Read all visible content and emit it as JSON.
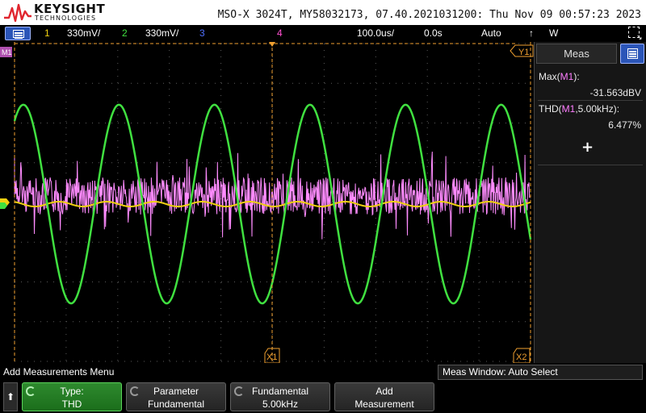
{
  "header": {
    "brand": "KEYSIGHT",
    "sub": "TECHNOLOGIES",
    "title": "MSO-X 3024T, MY58032173, 07.40.2021031200: Thu Nov 09 00:57:23 2023"
  },
  "status": {
    "ch1_num": "1",
    "ch1_scale": "330mV/",
    "ch2_num": "2",
    "ch2_scale": "330mV/",
    "ch3_num": "3",
    "ch4_num": "4",
    "timebase": "100.0us/",
    "delay": "0.0s",
    "trigger_mode": "Auto",
    "trigger_slope": "↑",
    "trigger_source": "W"
  },
  "display": {
    "marker_m1": "M1",
    "marker_y1": "Y1",
    "marker_x1": "X1",
    "marker_x2": "X2"
  },
  "colors": {
    "ch1": "#f0d010",
    "ch2": "#40e040",
    "ch3": "#5070ff",
    "ch4": "#ff4fd0",
    "math": "#ff8cff",
    "grid": "#5a5a5a"
  },
  "waveform_note": {
    "ch2_cycles": 5.4,
    "ch2_amplitude_div": 2.5
  },
  "measurements": {
    "panel_title": "Meas",
    "items": [
      {
        "label_pre": "Max(",
        "source": "M1",
        "label_post": "):",
        "value": "-31.563dBV"
      },
      {
        "label_pre": "THD(",
        "source": "M1",
        "label_post": ",5.00kHz):",
        "value": "6.477%"
      }
    ],
    "add_symbol": "+"
  },
  "softkeys": {
    "menu_title": "Add Measurements Menu",
    "meas_window": "Meas Window: Auto Select",
    "up_icon": "up-arrow-icon",
    "keys": [
      {
        "line1": "Type:",
        "line2": "THD",
        "active": true,
        "knob": true
      },
      {
        "line1": "Parameter",
        "line2": "Fundamental",
        "active": false,
        "knob": true
      },
      {
        "line1": "Fundamental",
        "line2": "5.00kHz",
        "active": false,
        "knob": true
      },
      {
        "line1": "Add",
        "line2": "Measurement",
        "active": false,
        "knob": false
      }
    ]
  }
}
